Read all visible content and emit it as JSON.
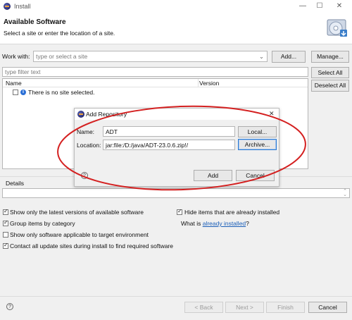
{
  "window": {
    "title": "Install",
    "minimize": "—",
    "maximize": "☐",
    "close": "✕"
  },
  "header": {
    "title": "Available Software",
    "subtitle": "Select a site or enter the location of a site."
  },
  "work_with": {
    "label": "Work with:",
    "placeholder": "type or select a site",
    "add_label": "Add...",
    "manage_label": "Manage..."
  },
  "filter": {
    "placeholder": "type filter text"
  },
  "table": {
    "col_name": "Name",
    "col_version": "Version",
    "empty_message": "There is no site selected."
  },
  "side_buttons": {
    "select_all": "Select All",
    "deselect_all": "Deselect All"
  },
  "dialog": {
    "title": "Add Repository",
    "name_label": "Name:",
    "name_value": "ADT",
    "location_label": "Location:",
    "location_value": "jar:file:/D:/java/ADT-23.0.6.zip!/",
    "local_label": "Local...",
    "archive_label": "Archive...",
    "add_label": "Add",
    "cancel_label": "Cancel"
  },
  "details": {
    "label": "Details"
  },
  "options": {
    "latest_versions": {
      "label": "Show only the latest versions of available software",
      "checked": true
    },
    "hide_installed": {
      "label": "Hide items that are already installed",
      "checked": true
    },
    "group_by_category": {
      "label": "Group items by category",
      "checked": true
    },
    "what_is": "What is",
    "already_installed_link": "already installed",
    "question_mark": "?",
    "target_env": {
      "label": "Show only software applicable to target environment",
      "checked": false
    },
    "contact_sites": {
      "label": "Contact all update sites during install to find required software",
      "checked": true
    }
  },
  "footer": {
    "back": "< Back",
    "next": "Next >",
    "finish": "Finish",
    "cancel": "Cancel"
  },
  "colors": {
    "annotation_ellipse": "#d42020",
    "link": "#1b5fb8",
    "focus_border": "#2b7bd3"
  }
}
